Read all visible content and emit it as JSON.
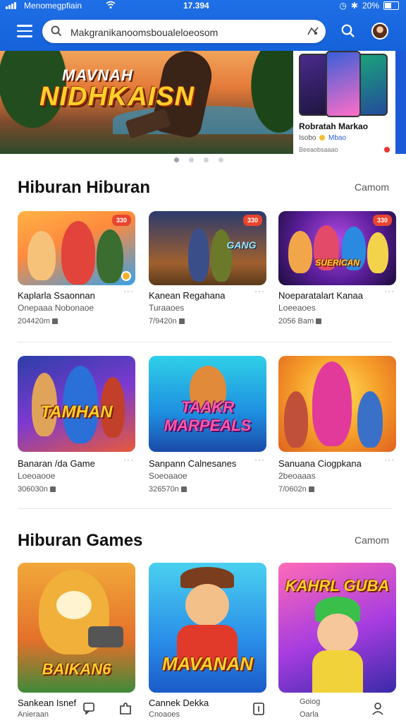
{
  "status_bar": {
    "carrier": "Menomegpfiain",
    "time": "17.394",
    "battery": "20%"
  },
  "search": {
    "value": "Makgranikanoomsboualeloeosom"
  },
  "banner": {
    "hero_line1": "MAVNAH",
    "hero_line2": "NIDHKAISN",
    "promo_title": "Robratah Markao",
    "promo_sub": "Isobo",
    "promo_sub_tag": "Mbao",
    "promo_sub2": "Beeaobsaaao"
  },
  "section1": {
    "title": "Hiburan Hiburan",
    "more": "Camom",
    "cards": [
      {
        "title": "Kaplarla Ssaonnan",
        "subtitle": "Onepaaa Nobonaoe",
        "meta": "204420m",
        "badge": "330"
      },
      {
        "title": "Kanean Regahana",
        "subtitle": "Turaaoes",
        "meta": "7/9420n",
        "badge": "330",
        "logo": "GANG"
      },
      {
        "title": "Noeparatalart Kanaa",
        "subtitle": "Loeeaoes",
        "meta": "2056 Bam",
        "badge": "330",
        "logo": "SUERICAN"
      },
      {
        "title": "Banaran /da Game",
        "subtitle": "Loeoaooe",
        "meta": "306030n",
        "logo": "TAMHAN"
      },
      {
        "title": "Sanpann Calnesanes",
        "subtitle": "Soeoaaoe",
        "meta": "326570n",
        "logo": "TAAKR MARPEALS"
      },
      {
        "title": "Sanuana Ciogpkana",
        "subtitle": "2beoaaas",
        "meta": "7/0602n"
      }
    ]
  },
  "section2": {
    "title": "Hiburan Games",
    "more": "Camom",
    "cards": [
      {
        "logo": "BAIKAN6"
      },
      {
        "logo": "MAVANAN"
      },
      {
        "logo": "KAHRL GUBA"
      }
    ]
  },
  "bottom_nav": {
    "left_label": "Sankean Isnef",
    "left_sub": "Anieraan",
    "mid_label": "Cannek Dekka",
    "mid_sub": "Cnoaoes",
    "right_label": "Goiog",
    "right_sub": "Oarla"
  },
  "colors": {
    "appbar": "#1f6fe6",
    "badge": "#e8452f"
  },
  "icons": [
    "menu-icon",
    "search-icon",
    "clear-icon",
    "avatar",
    "more-icon",
    "download-icon",
    "chat-icon",
    "puzzle-icon",
    "library-icon",
    "profile-icon"
  ]
}
